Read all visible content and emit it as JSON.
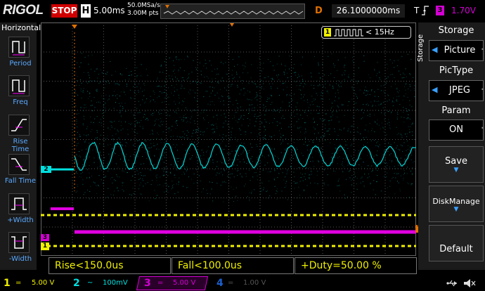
{
  "top": {
    "logo": "RIGOL",
    "run_state": "STOP",
    "h_label": "H",
    "timebase": "5.00ms",
    "sample_rate": "50.0MSa/s",
    "mem_depth": "3.00M pts",
    "d_label": "D",
    "delay": "26.1000000ms",
    "trig_t": "T",
    "trig_source": "3",
    "trig_level": "1.70V"
  },
  "left_menu": {
    "title": "Horizontal",
    "items": [
      {
        "label": "Period",
        "icon": "period-icon"
      },
      {
        "label": "Freq",
        "icon": "freq-icon"
      },
      {
        "label": "Rise Time",
        "icon": "rise-time-icon"
      },
      {
        "label": "Fall Time",
        "icon": "fall-time-icon"
      },
      {
        "label": "+Width",
        "icon": "pos-width-icon"
      },
      {
        "label": "-Width",
        "icon": "neg-width-icon"
      }
    ]
  },
  "freq_counter": {
    "channel": "1",
    "text": "< 15Hz"
  },
  "markers": {
    "ch2": "2",
    "ch3": "3",
    "ch1": "1",
    "trig": "T"
  },
  "measurements": [
    "Rise<150.0us",
    "Fall<100.0us",
    "+Duty=50.00 %"
  ],
  "right_menu": {
    "vertical_title": "Storage",
    "storage_title": "Storage",
    "storage_value": "Picture",
    "pictype_title": "PicType",
    "pictype_value": "JPEG",
    "param_title": "Param",
    "param_value": "ON",
    "save_label": "Save",
    "diskmanage_label": "DiskManage",
    "default_label": "Default"
  },
  "channels": [
    {
      "num": "1",
      "coupling": "=",
      "scale": "5.00 V",
      "color": "#f0f000"
    },
    {
      "num": "2",
      "coupling": "~",
      "scale": "100mV",
      "color": "#00e0e0"
    },
    {
      "num": "3",
      "coupling": "=",
      "scale": "5.00 V",
      "color": "#d400d4"
    },
    {
      "num": "4",
      "coupling": "=",
      "scale": "1.00 V",
      "color": "#1c5fcc"
    }
  ],
  "colors": {
    "ch1": "#f0f000",
    "ch2": "#00e0e0",
    "ch3": "#d400d4",
    "trigger": "#e07000"
  }
}
